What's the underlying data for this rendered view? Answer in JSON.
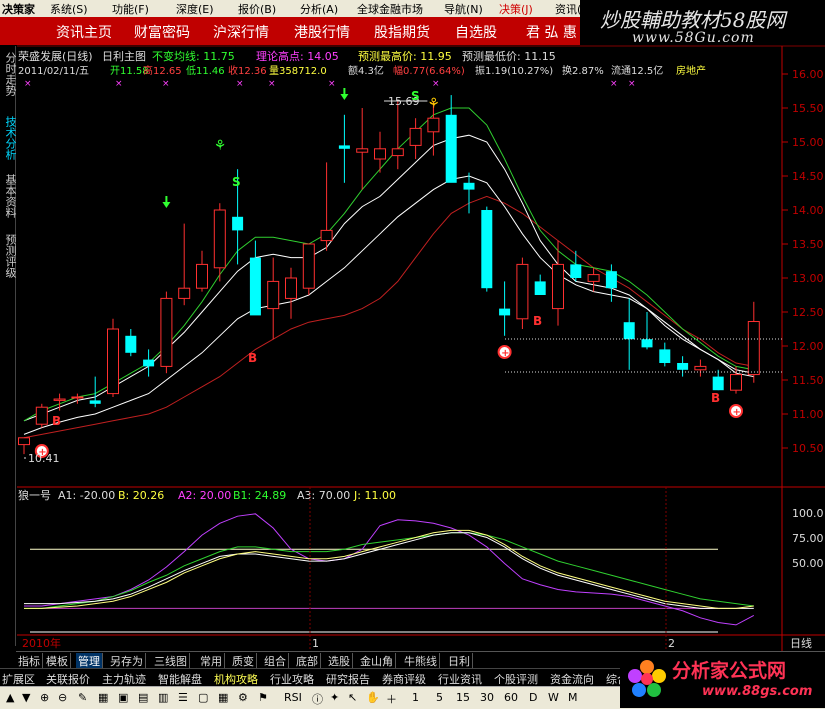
{
  "menubar": {
    "logo": "决策家",
    "items": [
      "系统(S)",
      "功能(F)",
      "深度(E)",
      "报价(B)",
      "分析(A)",
      "全球金融市场",
      "导航(N)",
      "决策(J)",
      "资讯(I)"
    ]
  },
  "navbar": {
    "items": [
      "资讯主页",
      "财富密码",
      "沪深行情",
      "港股行情",
      "股指期货",
      "自选股",
      "君 弘 惠"
    ]
  },
  "watermark_top": {
    "line1": "炒股輔助教材58股网",
    "line2": "www.58Gu.com"
  },
  "left_tabs": [
    {
      "label": "分时走势",
      "active": false
    },
    {
      "label": "技术分析",
      "active": true
    },
    {
      "label": "基本资料",
      "active": false
    },
    {
      "label": "预测评级",
      "active": false
    }
  ],
  "chart_header": {
    "stock_name": "荣盛发展(日线)",
    "chart_type": "日利主图",
    "indicator_label": "不变均线: 11.75",
    "theory_high": "理论高点: 14.05",
    "predict_high": "预测最高价: 11.95",
    "predict_low": "预测最低价: 11.15",
    "info_line": {
      "date": "2011/02/11/五",
      "open": "开11.58",
      "high": "高12.65",
      "low": "低11.46",
      "close": "收12.36",
      "volume": "量358712.0",
      "amount": "额4.3亿",
      "change": "幅0.77(6.64%)",
      "amplitude": "振1.19(10.27%)",
      "turnover": "换2.87%",
      "float_cap": "流通12.5亿",
      "sector": "房地产"
    }
  },
  "annotations": {
    "high_label": "15.69",
    "low_label": "10.41",
    "buy_marks": [
      "B",
      "B",
      "B",
      "B"
    ],
    "sell_marks": [
      "S",
      "S"
    ]
  },
  "price_axis": [
    "16.00",
    "15.50",
    "15.00",
    "14.50",
    "14.00",
    "13.50",
    "13.00",
    "12.50",
    "12.00",
    "11.50",
    "11.00",
    "10.50"
  ],
  "indicator_header": {
    "name": "狼一号",
    "a1": "A1: -20.00",
    "b": "B: 20.26",
    "a2": "A2: 20.00",
    "b1": "B1: 24.89",
    "a3": "A3: 70.00",
    "j": "J: 11.00"
  },
  "indicator_axis": [
    "100.0",
    "75.00",
    "50.00"
  ],
  "time_axis": {
    "year": "2010年",
    "m1": "1",
    "m2": "2",
    "period": "日线"
  },
  "bottom_tabs": [
    "指标",
    "模板",
    "管理",
    "另存为",
    "三线图",
    "常用",
    "质变",
    "组合",
    "底部",
    "选股",
    "金山角",
    "牛熊线",
    "日利"
  ],
  "bottom_tabs_active": "管理",
  "bottom_bar": [
    "扩展区",
    "关联报价",
    "主力轨迹",
    "智能解盘",
    "机构攻略",
    "行业攻略",
    "研究报告",
    "券商评级",
    "行业资讯",
    "个股评测",
    "资金流向",
    "综合"
  ],
  "toolbar": [
    "1",
    "5",
    "15",
    "30",
    "60",
    "D",
    "W",
    "M",
    "RSI"
  ],
  "watermark_bottom": {
    "line1": "分析家公式网",
    "line2": "www.88gs.com"
  },
  "colors": {
    "up": "#ff3030",
    "down": "#00ffff",
    "ma_white": "#ffffff",
    "ma_green": "#30d030",
    "ma_red": "#c02020",
    "nav_bg": "#c00000"
  },
  "chart_data": {
    "type": "candlestick",
    "ylim": [
      10.2,
      16.2
    ],
    "candles": [
      {
        "o": 10.55,
        "h": 10.65,
        "l": 10.41,
        "c": 10.65
      },
      {
        "o": 10.85,
        "h": 11.15,
        "l": 10.8,
        "c": 11.1
      },
      {
        "o": 11.2,
        "h": 11.3,
        "l": 11.05,
        "c": 11.22
      },
      {
        "o": 11.25,
        "h": 11.3,
        "l": 11.15,
        "c": 11.25
      },
      {
        "o": 11.2,
        "h": 11.55,
        "l": 11.1,
        "c": 11.15
      },
      {
        "o": 11.3,
        "h": 12.4,
        "l": 11.25,
        "c": 12.25
      },
      {
        "o": 12.15,
        "h": 12.25,
        "l": 11.85,
        "c": 11.9
      },
      {
        "o": 11.8,
        "h": 11.95,
        "l": 11.55,
        "c": 11.7
      },
      {
        "o": 11.7,
        "h": 12.8,
        "l": 11.6,
        "c": 12.7
      },
      {
        "o": 12.7,
        "h": 13.8,
        "l": 12.6,
        "c": 12.85
      },
      {
        "o": 12.85,
        "h": 13.4,
        "l": 12.8,
        "c": 13.2
      },
      {
        "o": 13.15,
        "h": 14.1,
        "l": 12.95,
        "c": 14.0
      },
      {
        "o": 13.9,
        "h": 14.6,
        "l": 13.2,
        "c": 13.7
      },
      {
        "o": 13.3,
        "h": 13.55,
        "l": 12.8,
        "c": 12.45
      },
      {
        "o": 12.55,
        "h": 13.3,
        "l": 12.1,
        "c": 12.95
      },
      {
        "o": 12.7,
        "h": 13.15,
        "l": 12.4,
        "c": 13.0
      },
      {
        "o": 12.85,
        "h": 13.5,
        "l": 12.75,
        "c": 13.5
      },
      {
        "o": 13.55,
        "h": 14.7,
        "l": 13.4,
        "c": 13.7
      },
      {
        "o": 14.95,
        "h": 15.4,
        "l": 14.4,
        "c": 14.9
      },
      {
        "o": 14.85,
        "h": 15.5,
        "l": 14.3,
        "c": 14.9
      },
      {
        "o": 14.75,
        "h": 15.15,
        "l": 14.55,
        "c": 14.9
      },
      {
        "o": 14.8,
        "h": 15.6,
        "l": 14.6,
        "c": 14.9
      },
      {
        "o": 14.95,
        "h": 15.35,
        "l": 14.75,
        "c": 15.2
      },
      {
        "o": 15.15,
        "h": 15.6,
        "l": 14.8,
        "c": 15.35
      },
      {
        "o": 15.4,
        "h": 15.69,
        "l": 14.95,
        "c": 14.4
      },
      {
        "o": 14.4,
        "h": 14.55,
        "l": 13.95,
        "c": 14.3
      },
      {
        "o": 14.0,
        "h": 14.05,
        "l": 12.8,
        "c": 12.85
      },
      {
        "o": 12.55,
        "h": 12.95,
        "l": 12.15,
        "c": 12.45
      },
      {
        "o": 12.4,
        "h": 13.3,
        "l": 12.25,
        "c": 13.2
      },
      {
        "o": 12.95,
        "h": 13.05,
        "l": 12.8,
        "c": 12.75
      },
      {
        "o": 12.55,
        "h": 13.55,
        "l": 12.3,
        "c": 13.2
      },
      {
        "o": 13.2,
        "h": 13.4,
        "l": 12.95,
        "c": 13.0
      },
      {
        "o": 12.95,
        "h": 13.15,
        "l": 12.8,
        "c": 13.05
      },
      {
        "o": 13.1,
        "h": 13.2,
        "l": 12.65,
        "c": 12.85
      },
      {
        "o": 12.35,
        "h": 12.7,
        "l": 11.65,
        "c": 12.1
      },
      {
        "o": 12.1,
        "h": 12.5,
        "l": 11.95,
        "c": 11.98
      },
      {
        "o": 11.95,
        "h": 12.05,
        "l": 11.7,
        "c": 11.75
      },
      {
        "o": 11.75,
        "h": 11.85,
        "l": 11.55,
        "c": 11.65
      },
      {
        "o": 11.65,
        "h": 11.8,
        "l": 11.55,
        "c": 11.7
      },
      {
        "o": 11.55,
        "h": 11.65,
        "l": 11.35,
        "c": 11.35
      },
      {
        "o": 11.35,
        "h": 11.7,
        "l": 11.3,
        "c": 11.58
      },
      {
        "o": 11.58,
        "h": 12.65,
        "l": 11.46,
        "c": 12.36
      }
    ],
    "ma_white1": [
      10.9,
      11.0,
      11.1,
      11.2,
      11.25,
      11.4,
      11.55,
      11.7,
      11.95,
      12.2,
      12.5,
      12.8,
      13.1,
      13.3,
      13.35,
      13.3,
      13.3,
      13.45,
      13.8,
      14.05,
      14.2,
      14.45,
      14.7,
      14.95,
      15.05,
      15.1,
      15.0,
      14.6,
      14.1,
      13.55,
      13.2,
      12.95,
      12.9,
      12.85,
      12.75,
      12.55,
      12.3,
      12.1,
      11.95,
      11.8,
      11.6,
      11.55
    ],
    "ma_white2": [
      10.7,
      10.8,
      10.88,
      10.95,
      11.0,
      11.1,
      11.2,
      11.3,
      11.5,
      11.7,
      11.9,
      12.15,
      12.4,
      12.55,
      12.6,
      12.65,
      12.75,
      12.95,
      13.15,
      13.4,
      13.65,
      13.9,
      14.1,
      14.3,
      14.45,
      14.5,
      14.4,
      14.05,
      13.65,
      13.3,
      13.05,
      12.9,
      12.8,
      12.75,
      12.7,
      12.55,
      12.35,
      12.15,
      11.95,
      11.8,
      11.65,
      11.6
    ],
    "ma_green": [
      10.9,
      11.05,
      11.15,
      11.25,
      11.3,
      11.45,
      11.6,
      11.75,
      12.0,
      12.3,
      12.65,
      13.05,
      13.4,
      13.6,
      13.6,
      13.55,
      13.5,
      13.65,
      13.95,
      14.3,
      14.6,
      14.9,
      15.15,
      15.4,
      15.5,
      15.5,
      15.25,
      14.75,
      14.2,
      13.7,
      13.4,
      13.2,
      13.15,
      13.1,
      12.95,
      12.75,
      12.5,
      12.25,
      12.05,
      11.85,
      11.7,
      11.65
    ],
    "ma_red": [
      10.65,
      10.7,
      10.75,
      10.8,
      10.85,
      10.9,
      10.95,
      11.0,
      11.1,
      11.25,
      11.4,
      11.55,
      11.75,
      11.95,
      12.1,
      12.25,
      12.35,
      12.4,
      12.45,
      12.55,
      12.7,
      12.95,
      13.3,
      13.65,
      13.95,
      14.1,
      14.2,
      14.1,
      13.95,
      13.75,
      13.55,
      13.35,
      13.15,
      13.0,
      12.85,
      12.65,
      12.45,
      12.25,
      12.1,
      11.9,
      11.75,
      11.7
    ],
    "indicator": {
      "ylim": [
        0,
        110
      ],
      "purple": [
        22,
        22,
        24,
        26,
        28,
        30,
        36,
        44,
        55,
        68,
        82,
        92,
        98,
        100,
        88,
        70,
        62,
        60,
        62,
        70,
        90,
        95,
        94,
        92,
        88,
        82,
        72,
        58,
        45,
        40,
        36,
        34,
        33,
        32,
        30,
        26,
        22,
        18,
        12,
        8,
        6,
        14
      ],
      "green": [
        20,
        20,
        22,
        24,
        26,
        30,
        35,
        42,
        48,
        56,
        62,
        68,
        72,
        72,
        70,
        68,
        68,
        68,
        70,
        74,
        76,
        78,
        80,
        82,
        84,
        84,
        82,
        78,
        72,
        66,
        60,
        56,
        52,
        48,
        44,
        40,
        36,
        32,
        28,
        26,
        24,
        22
      ],
      "yellow": [
        20,
        20,
        21,
        22,
        24,
        26,
        30,
        36,
        42,
        50,
        56,
        62,
        66,
        68,
        66,
        64,
        62,
        62,
        64,
        68,
        72,
        76,
        80,
        84,
        86,
        86,
        82,
        74,
        64,
        56,
        50,
        46,
        42,
        38,
        34,
        30,
        26,
        24,
        22,
        20,
        20,
        22
      ],
      "white": [
        24,
        24,
        24,
        25,
        26,
        28,
        32,
        38,
        45,
        52,
        58,
        64,
        66,
        66,
        64,
        62,
        60,
        60,
        62,
        66,
        70,
        74,
        78,
        82,
        84,
        84,
        80,
        72,
        62,
        54,
        48,
        44,
        40,
        36,
        32,
        28,
        24,
        22,
        20,
        20,
        20,
        20
      ],
      "h_lines": [
        70,
        20,
        0
      ]
    }
  }
}
